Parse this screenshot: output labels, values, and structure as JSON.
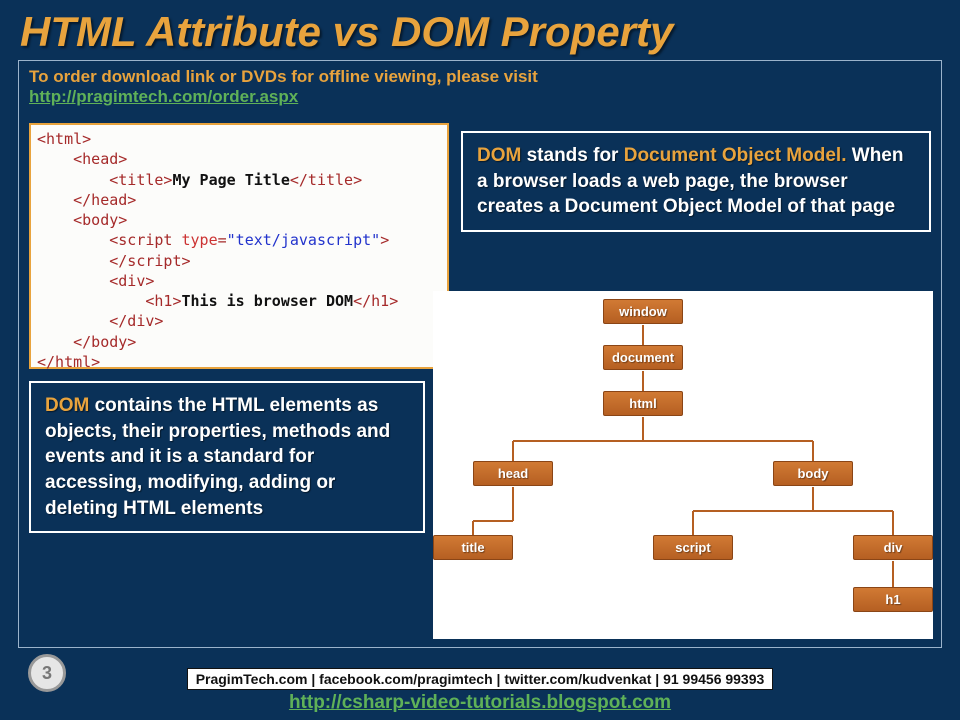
{
  "title": "HTML Attribute vs DOM Property",
  "order": {
    "text": "To order download link or DVDs for offline viewing, please visit",
    "link": "http://pragimtech.com/order.aspx"
  },
  "code": {
    "t_html_o": "<html>",
    "t_head_o": "<head>",
    "t_title_o": "<title>",
    "title_text": "My Page Title",
    "t_title_c": "</title>",
    "t_head_c": "</head>",
    "t_body_o": "<body>",
    "t_script_o1": "<script",
    "t_script_attr_name": "type",
    "t_script_eq": "=",
    "t_script_attr_val": "\"text/javascript\"",
    "t_script_o2": ">",
    "t_script_c": "</script>",
    "t_div_o": "<div>",
    "t_h1_o": "<h1>",
    "h1_text": "This is browser DOM",
    "t_h1_c": "</h1>",
    "t_div_c": "</div>",
    "t_body_c": "</body>",
    "t_html_c": "</html>"
  },
  "info_top": {
    "gold1": "DOM",
    "t1": " stands for ",
    "gold2": "Document Object Model.",
    "t2": " When a browser loads a web page, the browser creates a Document Object Model of that page"
  },
  "info_left": {
    "gold1": "DOM",
    "t1": " contains the HTML elements as objects, their properties, methods and events and it is a standard for accessing, modifying, adding or deleting HTML elements"
  },
  "tree": {
    "window": "window",
    "document": "document",
    "html": "html",
    "head": "head",
    "body": "body",
    "title": "title",
    "script": "script",
    "div": "div",
    "h1": "h1"
  },
  "footer": {
    "contacts": "PragimTech.com | facebook.com/pragimtech | twitter.com/kudvenkat | 91 99456 99393",
    "link": "http://csharp-video-tutorials.blogspot.com"
  },
  "page_number": "3"
}
